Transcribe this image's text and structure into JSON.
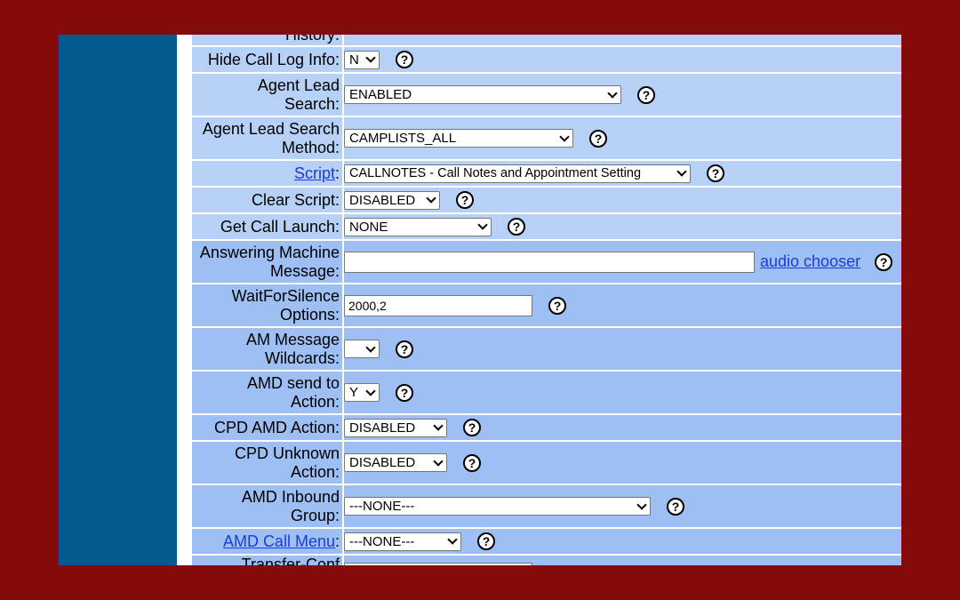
{
  "colors": {
    "frame": "#850a0a",
    "sidebar": "#04598f",
    "row_light": "#b7d0f6",
    "row_dark": "#9dbff4",
    "link": "#1a3cd8"
  },
  "help_symbol": "?",
  "fields": [
    {
      "label": "History:"
    },
    {
      "label": "Hide Call Log Info:",
      "select": "N"
    },
    {
      "label_lines": [
        "Agent Lead",
        "Search:"
      ],
      "select": "ENABLED"
    },
    {
      "label_lines": [
        "Agent Lead Search",
        "Method:"
      ],
      "select": "CAMPLISTS_ALL"
    },
    {
      "link_label": "Script",
      "select": "CALLNOTES - Call Notes and Appointment Setting"
    },
    {
      "label": "Clear Script:",
      "select": "DISABLED"
    },
    {
      "label": "Get Call Launch:",
      "select": "NONE"
    },
    {
      "label_lines": [
        "Answering Machine",
        "Message:"
      ],
      "input": "",
      "link": "audio chooser"
    },
    {
      "label_lines": [
        "WaitForSilence",
        "Options:"
      ],
      "input": "2000,2"
    },
    {
      "label_lines": [
        "AM Message",
        "Wildcards:"
      ],
      "select": ""
    },
    {
      "label_lines": [
        "AMD send to",
        "Action:"
      ],
      "select": "Y"
    },
    {
      "label": "CPD AMD Action:",
      "select": "DISABLED"
    },
    {
      "label_lines": [
        "CPD Unknown",
        "Action:"
      ],
      "select": "DISABLED"
    },
    {
      "label_lines": [
        "AMD Inbound",
        "Group:"
      ],
      "select": "---NONE---"
    },
    {
      "link_label": "AMD Call Menu",
      "select": "---NONE---"
    },
    {
      "label": "Transfer-Conf"
    }
  ]
}
